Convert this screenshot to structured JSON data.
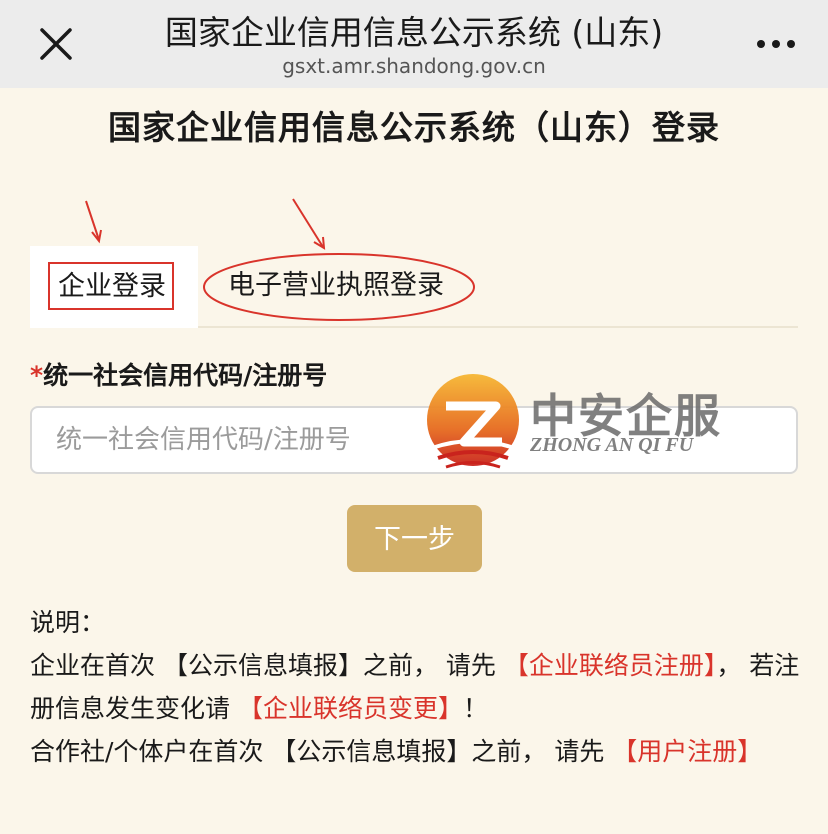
{
  "browser": {
    "title": "国家企业信用信息公示系统 (山东)",
    "url": "gsxt.amr.shandong.gov.cn"
  },
  "page": {
    "title": "国家企业信用信息公示系统（山东）登录"
  },
  "tabs": [
    {
      "label": "企业登录",
      "active": true
    },
    {
      "label": "电子营业执照登录",
      "active": false
    }
  ],
  "form": {
    "required_mark": "*",
    "label": "统一社会信用代码/注册号",
    "input_value": "",
    "input_placeholder": "统一社会信用代码/注册号",
    "next_label": "下一步"
  },
  "watermark": {
    "cn": "中安企服",
    "en": "ZHONG AN QI FU"
  },
  "notes": {
    "heading": "说明：",
    "line1_a": "企业在首次 【公示信息填报】之前， 请先 ",
    "link1": "【企业联络员注册】",
    "line1_b": "， 若注册信息发生变化请 ",
    "link2": "【企业联络员变更】",
    "line1_c": "！",
    "line2_a": "合作社/个体户在首次 【公示信息填报】之前， 请先 ",
    "link3": "【用户注册】"
  },
  "colors": {
    "accent_red": "#d9342b",
    "button_gold": "#d2b06a",
    "page_bg": "#fbf6ea"
  }
}
